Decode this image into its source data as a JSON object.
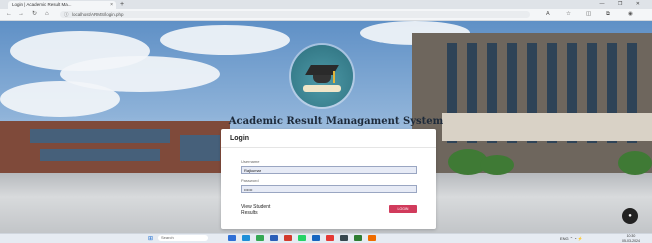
{
  "browser": {
    "tab_title": "Login | Academic Result Ma...",
    "tab_close": "×",
    "new_tab": "+",
    "window_controls": "— ❐ ✕",
    "url": "localhost/ARMS/login.php",
    "back": "←",
    "forward": "→",
    "reload": "↻",
    "home": "⌂"
  },
  "app": {
    "title": "Academic Result Managament System"
  },
  "login": {
    "heading": "Login",
    "username_label": "Username",
    "username_value": "Rajkumar",
    "password_label": "Password",
    "password_value": "••••••",
    "view_results_link": "View Student Results",
    "login_button": "LOGIN"
  },
  "taskbar": {
    "search_placeholder": "Search",
    "apps": [
      {
        "name": "explorer",
        "color": "#2f6fd6"
      },
      {
        "name": "edge",
        "color": "#1e8fd8"
      },
      {
        "name": "chrome",
        "color": "#34a853"
      },
      {
        "name": "mail",
        "color": "#2b5fb8"
      },
      {
        "name": "app-red",
        "color": "#d33a2c"
      },
      {
        "name": "whatsapp",
        "color": "#25d366"
      },
      {
        "name": "app-blue",
        "color": "#1565c0"
      },
      {
        "name": "app-red2",
        "color": "#e53935"
      },
      {
        "name": "app-dark",
        "color": "#37474f"
      },
      {
        "name": "app-green",
        "color": "#2e7d32"
      },
      {
        "name": "app-orange",
        "color": "#ef6c00"
      }
    ],
    "tray": "ENG  ⌃  ◔  ⚡",
    "time": "10:30",
    "date": "05-03-2024"
  },
  "colors": {
    "accent": "#d13b5c",
    "field_bg": "#e7ebf6"
  }
}
